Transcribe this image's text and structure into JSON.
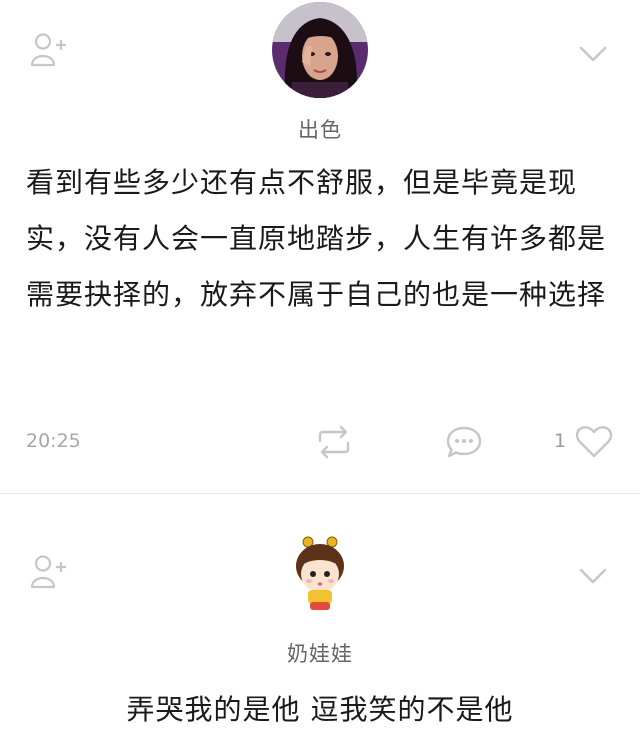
{
  "posts": [
    {
      "nickname": "出色",
      "content": "看到有些多少还有点不舒服，但是毕竟是现实，没有人会一直原地踏步，人生有许多都是需要抉择的，放弃不属于自己的也是一种选择",
      "time": "20:25",
      "like_count": "1",
      "icons": {
        "follow": "add-friend-icon",
        "more": "chevron-down-icon",
        "repost": "repost-icon",
        "comment": "comment-icon",
        "like": "heart-icon"
      }
    },
    {
      "nickname": "奶娃娃",
      "content": "弄哭我的是他  逗我笑的不是他",
      "icons": {
        "follow": "add-friend-icon",
        "more": "chevron-down-icon"
      }
    }
  ],
  "colors": {
    "icon_gray": "#c6c6c6",
    "text_dark": "#1a1a1a",
    "nickname_gray": "#666666",
    "meta_gray": "#a8a8a8"
  }
}
